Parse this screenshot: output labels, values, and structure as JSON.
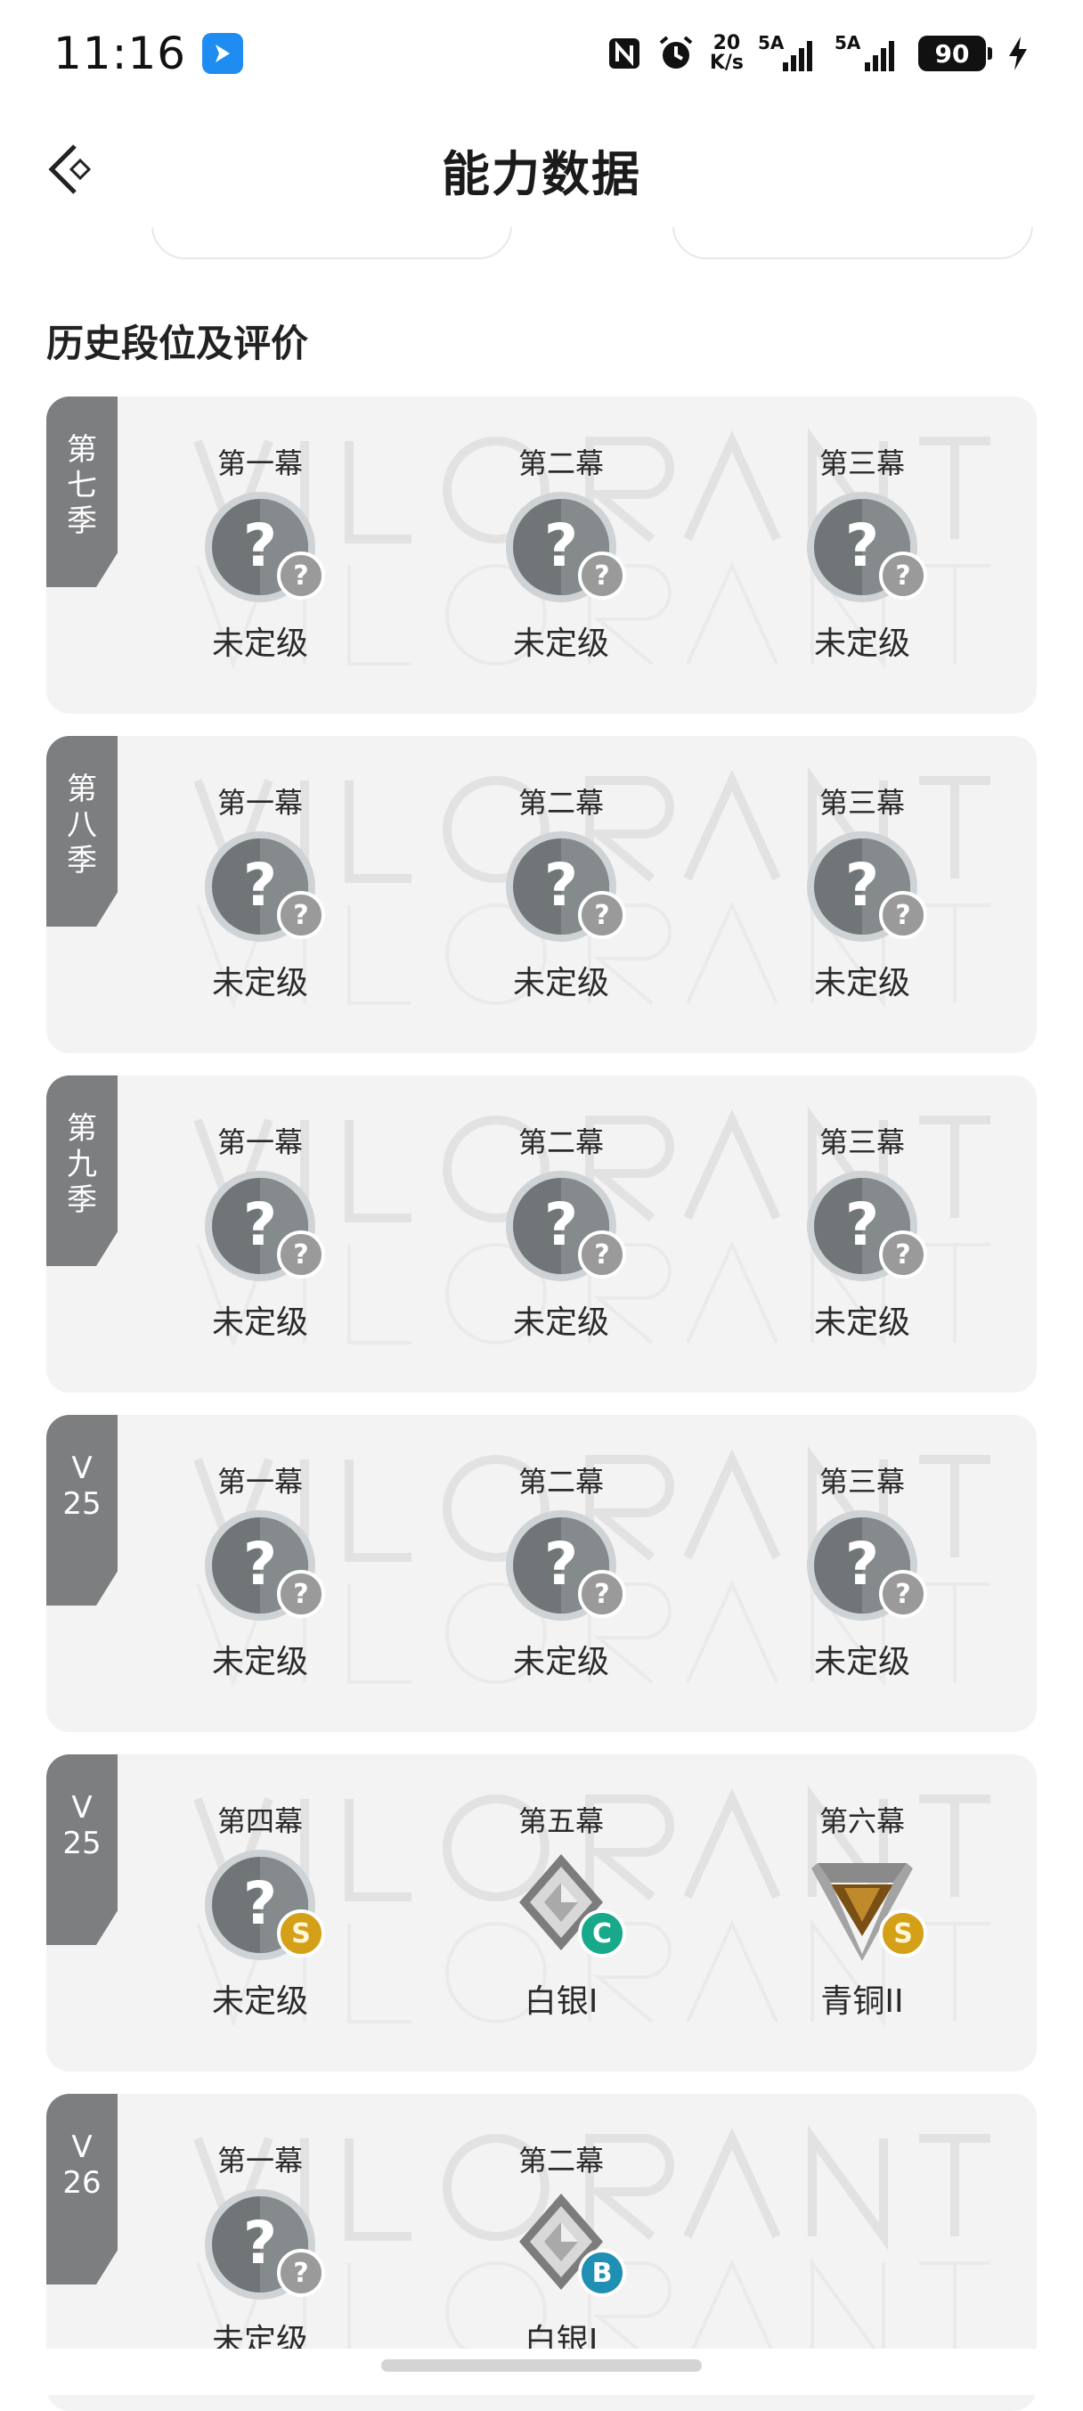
{
  "status_bar": {
    "time": "11:16",
    "net_speed_value": "20",
    "net_speed_unit": "K/s",
    "sim1_label": "5A",
    "sim2_label": "5A",
    "battery": "90"
  },
  "header": {
    "title": "能力数据"
  },
  "section": {
    "title": "历史段位及评价"
  },
  "seasons": [
    {
      "tag": [
        "第",
        "七",
        "季"
      ],
      "acts": [
        {
          "label": "第一幕",
          "rank": "未定级",
          "grade": "?"
        },
        {
          "label": "第二幕",
          "rank": "未定级",
          "grade": "?"
        },
        {
          "label": "第三幕",
          "rank": "未定级",
          "grade": "?"
        }
      ]
    },
    {
      "tag": [
        "第",
        "八",
        "季"
      ],
      "acts": [
        {
          "label": "第一幕",
          "rank": "未定级",
          "grade": "?"
        },
        {
          "label": "第二幕",
          "rank": "未定级",
          "grade": "?"
        },
        {
          "label": "第三幕",
          "rank": "未定级",
          "grade": "?"
        }
      ]
    },
    {
      "tag": [
        "第",
        "九",
        "季"
      ],
      "acts": [
        {
          "label": "第一幕",
          "rank": "未定级",
          "grade": "?"
        },
        {
          "label": "第二幕",
          "rank": "未定级",
          "grade": "?"
        },
        {
          "label": "第三幕",
          "rank": "未定级",
          "grade": "?"
        }
      ]
    },
    {
      "tag": [
        "V",
        "25"
      ],
      "acts": [
        {
          "label": "第一幕",
          "rank": "未定级",
          "grade": "?"
        },
        {
          "label": "第二幕",
          "rank": "未定级",
          "grade": "?"
        },
        {
          "label": "第三幕",
          "rank": "未定级",
          "grade": "?"
        }
      ]
    },
    {
      "tag": [
        "V",
        "25"
      ],
      "acts": [
        {
          "label": "第四幕",
          "rank": "未定级",
          "grade": "S"
        },
        {
          "label": "第五幕",
          "rank": "白银I",
          "grade": "C"
        },
        {
          "label": "第六幕",
          "rank": "青铜II",
          "grade": "S"
        }
      ]
    },
    {
      "tag": [
        "V",
        "26"
      ],
      "acts": [
        {
          "label": "第一幕",
          "rank": "未定级",
          "grade": "?"
        },
        {
          "label": "第二幕",
          "rank": "白银I",
          "grade": "B"
        }
      ]
    }
  ],
  "icons": {
    "back": "back-arrow-icon",
    "unranked": "unranked-question-icon",
    "silver": "silver-rank-icon",
    "bronze": "bronze-rank-icon"
  },
  "colors": {
    "card_bg": "#f3f3f3",
    "season_tag": "#7c7e80",
    "grade_s": "#d4a017",
    "grade_c": "#18a88a",
    "grade_b": "#1f8fb3"
  }
}
